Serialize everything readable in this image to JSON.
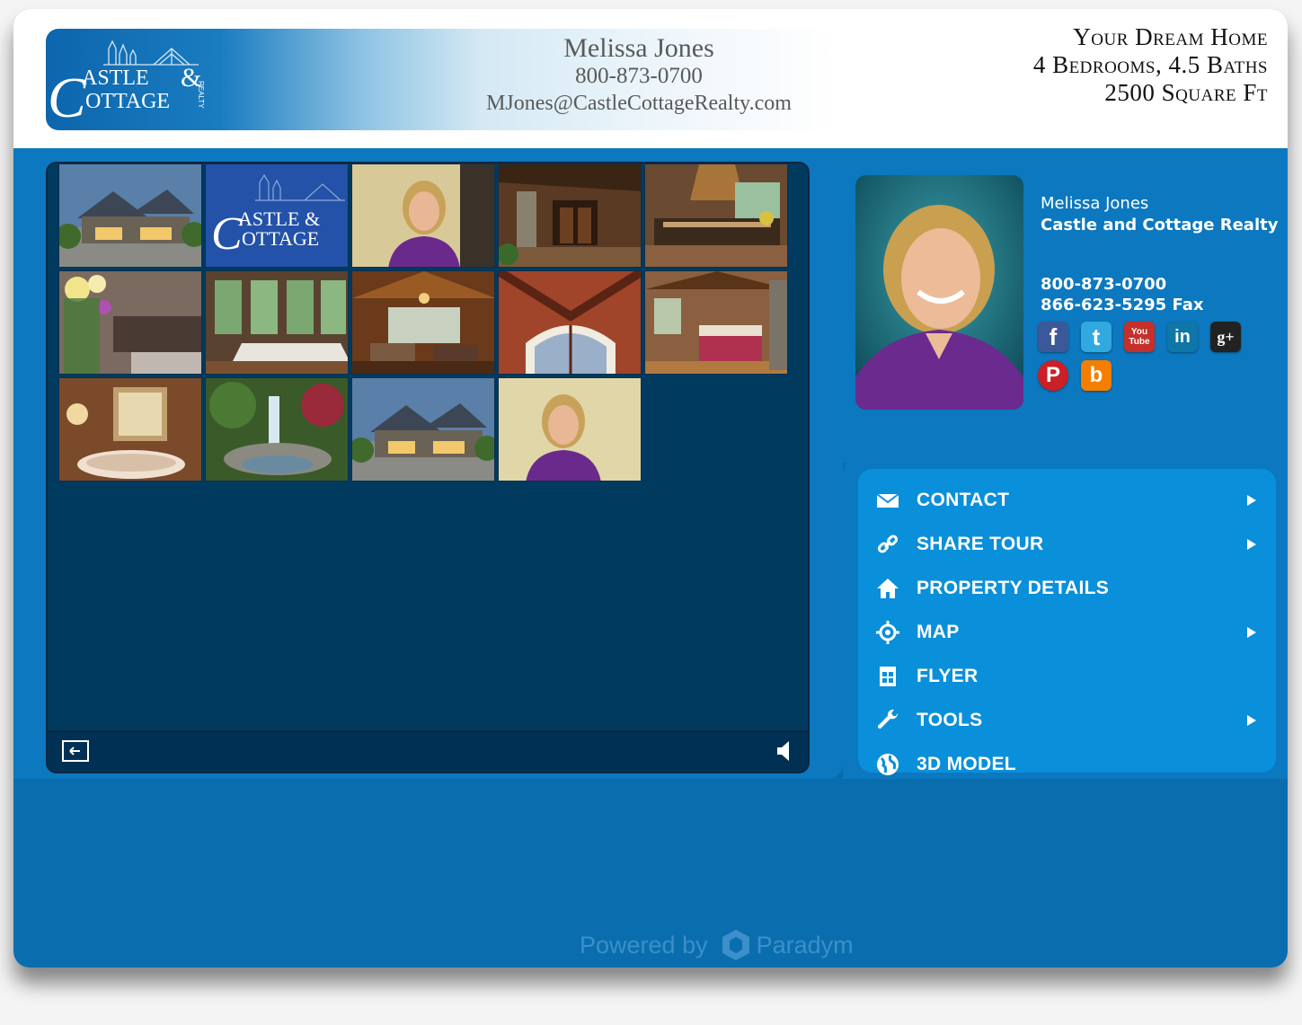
{
  "header": {
    "logo": {
      "line1": "ASTLE",
      "amp": "&",
      "line2": "OTTAGE",
      "script_c": "C",
      "sub": "REALTY"
    },
    "agent_name": "Melissa Jones",
    "agent_phone": "800-873-0700",
    "agent_email": "MJones@CastleCottageRealty.com",
    "home_info": [
      "Your Dream Home",
      "4 Bedrooms, 4.5 Baths",
      "2500 Square Ft"
    ]
  },
  "gallery": {
    "tiles": [
      {
        "label": "house-exterior-dusk"
      },
      {
        "label": "castle-cottage-logo"
      },
      {
        "label": "agent-portrait"
      },
      {
        "label": "entry-porch"
      },
      {
        "label": "kitchen"
      },
      {
        "label": "flowers-kitchen"
      },
      {
        "label": "dining-room"
      },
      {
        "label": "great-room"
      },
      {
        "label": "vaulted-ceiling"
      },
      {
        "label": "master-bedroom"
      },
      {
        "label": "bathroom-tub"
      },
      {
        "label": "waterfall-garden"
      },
      {
        "label": "house-exterior-dusk-2"
      },
      {
        "label": "agent-portrait-2"
      }
    ]
  },
  "agent_card": {
    "name": "Melissa Jones",
    "company": "Castle and Cottage Realty",
    "phone": "800-873-0700",
    "fax": "866-623-5295  Fax"
  },
  "socials": [
    {
      "name": "facebook",
      "glyph": "f",
      "color": "#3b5998"
    },
    {
      "name": "twitter",
      "glyph": "t",
      "color": "#2fa9e0"
    },
    {
      "name": "youtube",
      "glyph": "You Tube",
      "color": "#c4302b"
    },
    {
      "name": "linkedin",
      "glyph": "in",
      "color": "#0e76a8"
    },
    {
      "name": "google-plus",
      "glyph": "g+",
      "color": "#222222"
    },
    {
      "name": "pinterest",
      "glyph": "P",
      "color": "#cb2027"
    },
    {
      "name": "blogger",
      "glyph": "b",
      "color": "#f57d00"
    }
  ],
  "menu": {
    "items": [
      {
        "label": "CONTACT",
        "icon": "envelope-icon",
        "submenu": true
      },
      {
        "label": "SHARE TOUR",
        "icon": "link-icon",
        "submenu": true
      },
      {
        "label": "PROPERTY DETAILS",
        "icon": "home-icon",
        "submenu": false
      },
      {
        "label": "MAP",
        "icon": "crosshair-icon",
        "submenu": true
      },
      {
        "label": "FLYER",
        "icon": "document-icon",
        "submenu": false
      },
      {
        "label": "TOOLS",
        "icon": "wrench-icon",
        "submenu": true
      },
      {
        "label": "3D MODEL",
        "icon": "globe-icon",
        "submenu": false
      }
    ]
  },
  "footer": {
    "powered_by": "Powered by",
    "brand": "Paradym"
  },
  "colors": {
    "accent": "#0c78bf",
    "menu_bg": "#0a8fda",
    "viewer_bg": "#003a5f"
  }
}
